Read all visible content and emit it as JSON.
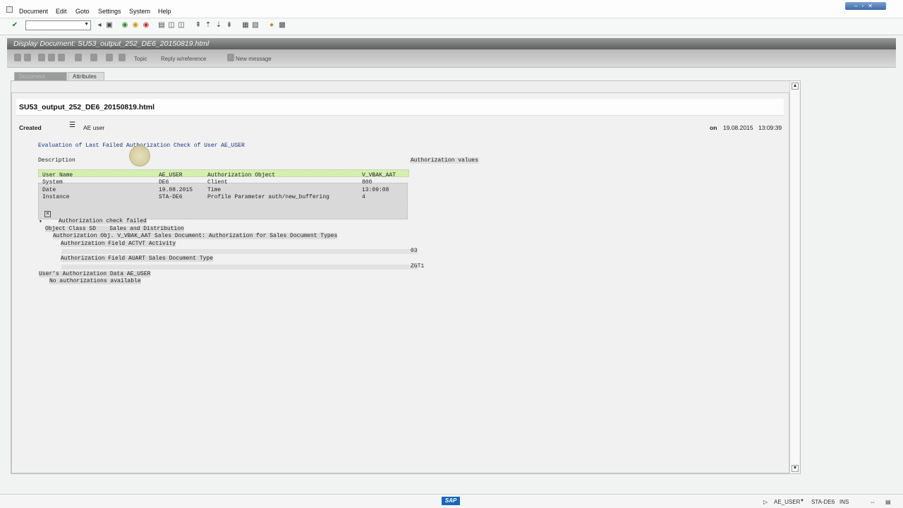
{
  "menubar": {
    "items": [
      "Document",
      "Edit",
      "Goto",
      "Settings",
      "System",
      "Help"
    ]
  },
  "toolbar": {
    "command_value": "",
    "icons": [
      "enter-icon",
      "back-icon",
      "save-icon",
      "green-back-icon",
      "exit-icon",
      "cancel-icon",
      "print-icon",
      "find-icon",
      "find-next-icon",
      "first-page-icon",
      "prev-page-icon",
      "next-page-icon",
      "last-page-icon",
      "new-session-icon",
      "shortcut-icon",
      "help-icon",
      "layout-icon"
    ]
  },
  "title": "Display Document: SU53_output_252_DE6_20150819.html",
  "app_toolbar": {
    "labels": [
      "Topic",
      "Reply w/reference",
      "New message"
    ]
  },
  "tabs": [
    {
      "label": "Document",
      "active": true
    },
    {
      "label": "Attributes",
      "active": false
    }
  ],
  "document": {
    "filename": "SU53_output_252_DE6_20150819.html",
    "created_label": "Created",
    "created_by": "AE user",
    "on_label": "on",
    "date": "19.08.2015",
    "time": "13:09:39",
    "heading": "Evaluation of Last Failed Authorization Check of User AE_USER",
    "description_header": "Description",
    "auth_values_header": "Authorization values",
    "grid": [
      [
        "User Name",
        "AE_USER",
        "Authorization Object",
        "V_VBAK_AAT"
      ],
      [
        "System",
        "DE6",
        "Client",
        "800"
      ],
      [
        "Date",
        "19.08.2015",
        "Time",
        "13:09:08"
      ],
      [
        "Instance",
        "STA-DE6",
        "Profile Parameter auth/new_buffering",
        "4"
      ]
    ],
    "tree": {
      "check_failed": "Authorization check failed",
      "object_class": "Object Class SD    Sales and Distribution",
      "auth_obj": "Authorization Obj. V_VBAK_AAT Sales Document: Authorization for Sales Document Types",
      "field_actvt": "Authorization Field ACTVT Activity",
      "actvt_value": "03",
      "field_auart": "Authorization Field AUART Sales Document Type",
      "auart_value": "ZGT1",
      "user_data": "User's Authorization Data AE_USER",
      "no_auth": "No authorizations available"
    }
  },
  "statusbar": {
    "logo": "SAP",
    "user": "AE_USER",
    "system": "STA-DE6",
    "mode": "INS"
  }
}
